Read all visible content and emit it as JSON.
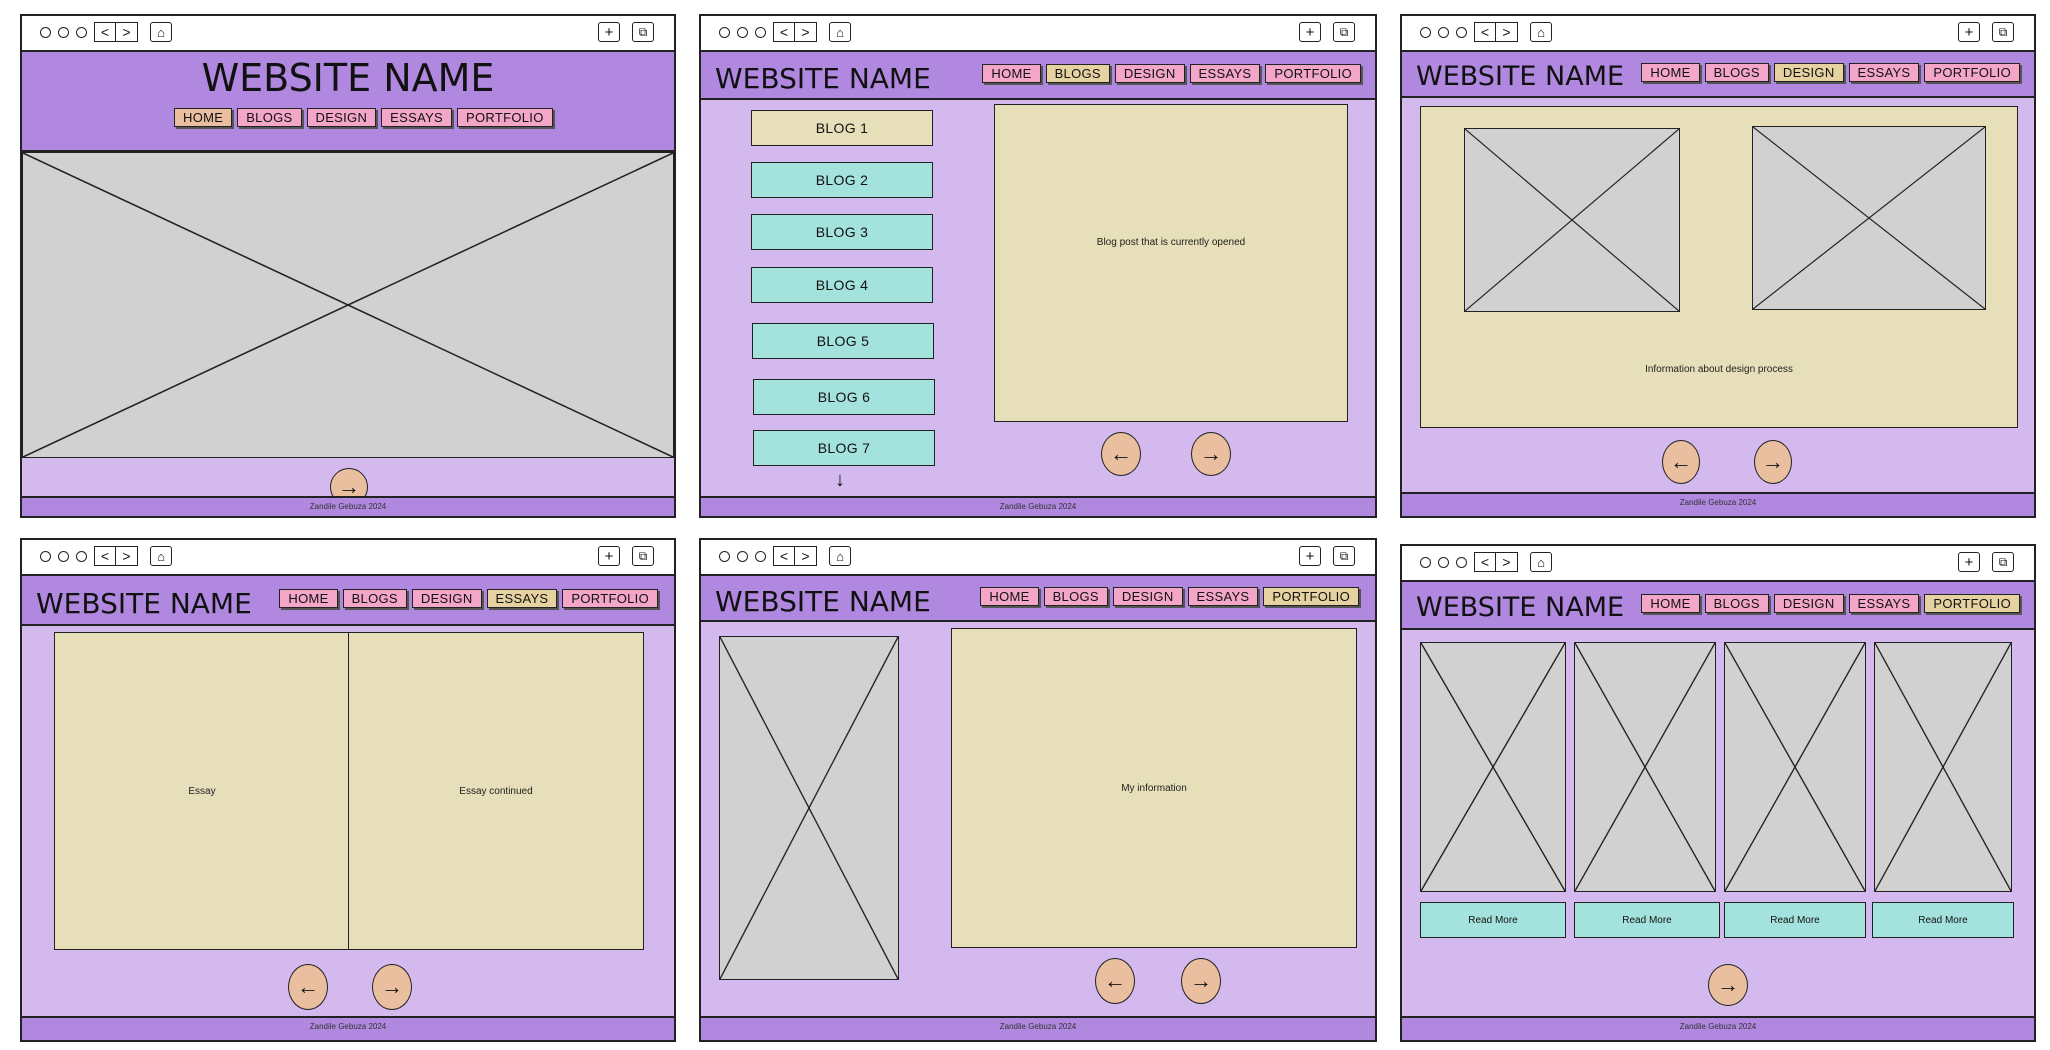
{
  "site_name": "WEBSITE NAME",
  "nav_items": [
    "HOME",
    "BLOGS",
    "DESIGN",
    "ESSAYS",
    "PORTFOLIO"
  ],
  "footer": "Zandile Gebuza 2024",
  "icons": {
    "back": "chevron-left-icon",
    "forward": "chevron-right-icon",
    "home": "home-icon",
    "new_tab": "plus-icon",
    "copy": "copy-icon",
    "arrow_left": "←",
    "arrow_right": "→",
    "arrow_down": "↓",
    "home_glyph": "⌂",
    "plus_glyph": "+",
    "copy_glyph": "⧉",
    "left_glyph": "<",
    "right_glyph": ">"
  },
  "colors": {
    "header": "#b088e0",
    "body": "#d3b9ee",
    "nav_button": "#f3a6c8",
    "nav_active": "#e9bf9f",
    "panel": "#e6dfb9",
    "placeholder": "#d1d1d1",
    "teal_button": "#a4e2dd"
  },
  "blogs_page": {
    "blog_list": [
      "BLOG 1",
      "BLOG 2",
      "BLOG 3",
      "BLOG 4",
      "BLOG 5",
      "BLOG 6",
      "BLOG 7"
    ],
    "content": "Blog post that is currently opened"
  },
  "design_page": {
    "content": "Information about design process"
  },
  "essays_page": {
    "left": "Essay",
    "right": "Essay continued"
  },
  "portfolio_page": {
    "content": "My information"
  },
  "gallery_page": {
    "read_more": "Read More"
  }
}
